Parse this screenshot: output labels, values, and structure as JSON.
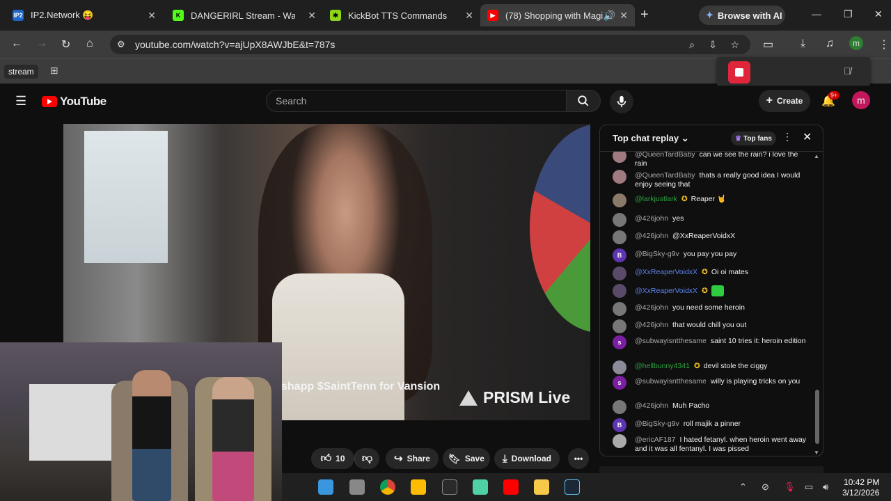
{
  "browser": {
    "tabs": [
      {
        "label": "IP2.Network 😝",
        "active": false
      },
      {
        "label": "DANGERIRL Stream - Watch",
        "active": false
      },
      {
        "label": "KickBot TTS Commands",
        "active": false
      },
      {
        "label": "(78) Shopping with Magi",
        "active": true
      }
    ],
    "browse_ai_label": "Browse with AI",
    "url": "youtube.com/watch?v=ajUpX8AWJbE&t=787s",
    "bookmark_label": "stream",
    "colors": {
      "tab_bar": "#1f1f1f",
      "toolbar": "#3c3c3c",
      "record_button": "#e0263a"
    }
  },
  "youtube": {
    "logo_text": "YouTube",
    "search_placeholder": "Search",
    "create_label": "Create",
    "notification_badge": "9+",
    "avatar_letter": "m",
    "video_overlay_text": "shapp $SaintTenn for Vansion",
    "prism_text": "PRISM Live",
    "actions": {
      "like_count": "10",
      "share": "Share",
      "save": "Save",
      "download": "Download"
    }
  },
  "chat": {
    "title": "Top chat replay",
    "top_fans_label": "Top fans",
    "messages": [
      {
        "user": "@QueenTardBaby",
        "text": "can we see the rain? i love the rain",
        "avatar": "",
        "avatar_color": "#a07a80",
        "style": "normal"
      },
      {
        "user": "@QueenTardBaby",
        "text": "thats a really good idea I would enjoy seeing that",
        "avatar": "",
        "avatar_color": "#a07a80",
        "style": "normal"
      },
      {
        "user": "@larkjustlark",
        "text": "Reaper 🤘",
        "avatar": "",
        "avatar_color": "#8a7a6a",
        "style": "member"
      },
      {
        "user": "@426john",
        "text": "yes",
        "avatar": "",
        "avatar_color": "#777777",
        "style": "normal"
      },
      {
        "user": "@426john",
        "text": "@XxReaperVoidxX",
        "avatar": "",
        "avatar_color": "#777777",
        "style": "normal"
      },
      {
        "user": "@BigSky-g9v",
        "text": "you pay you pay",
        "avatar": "B",
        "avatar_color": "#5e35b1",
        "style": "normal"
      },
      {
        "user": "@XxReaperVoidxX",
        "text": "Oi oi mates",
        "avatar": "",
        "avatar_color": "#5a4a6a",
        "style": "mod"
      },
      {
        "user": "@XxReaperVoidxX",
        "text": "",
        "avatar": "",
        "avatar_color": "#5a4a6a",
        "style": "mod"
      },
      {
        "user": "@426john",
        "text": "you need some heroin",
        "avatar": "",
        "avatar_color": "#777777",
        "style": "normal"
      },
      {
        "user": "@426john",
        "text": "that would chill you out",
        "avatar": "",
        "avatar_color": "#777777",
        "style": "normal"
      },
      {
        "user": "@subwayisntthesame",
        "text": "saint 10 tries it: heroin edition",
        "avatar": "s",
        "avatar_color": "#7b1fa2",
        "style": "normal"
      },
      {
        "user": "@hellbunny4341",
        "text": "devil stole the ciggy",
        "avatar": "",
        "avatar_color": "#8a8a9a",
        "style": "member"
      },
      {
        "user": "@subwayisntthesame",
        "text": "willy is playing tricks on you",
        "avatar": "s",
        "avatar_color": "#7b1fa2",
        "style": "normal"
      },
      {
        "user": "@426john",
        "text": "Muh Pacho",
        "avatar": "",
        "avatar_color": "#777777",
        "style": "normal"
      },
      {
        "user": "@BigSky-g9v",
        "text": "roll majik a pinner",
        "avatar": "B",
        "avatar_color": "#5e35b1",
        "style": "normal"
      },
      {
        "user": "@ericAF187",
        "text": "I hated fetanyl. when heroin went away and it was all fentanyl. I was pissed",
        "avatar": "",
        "avatar_color": "#aaaaaa",
        "style": "normal"
      }
    ]
  },
  "taskbar": {
    "time": "10:42 PM",
    "date": "3/12/2026"
  }
}
